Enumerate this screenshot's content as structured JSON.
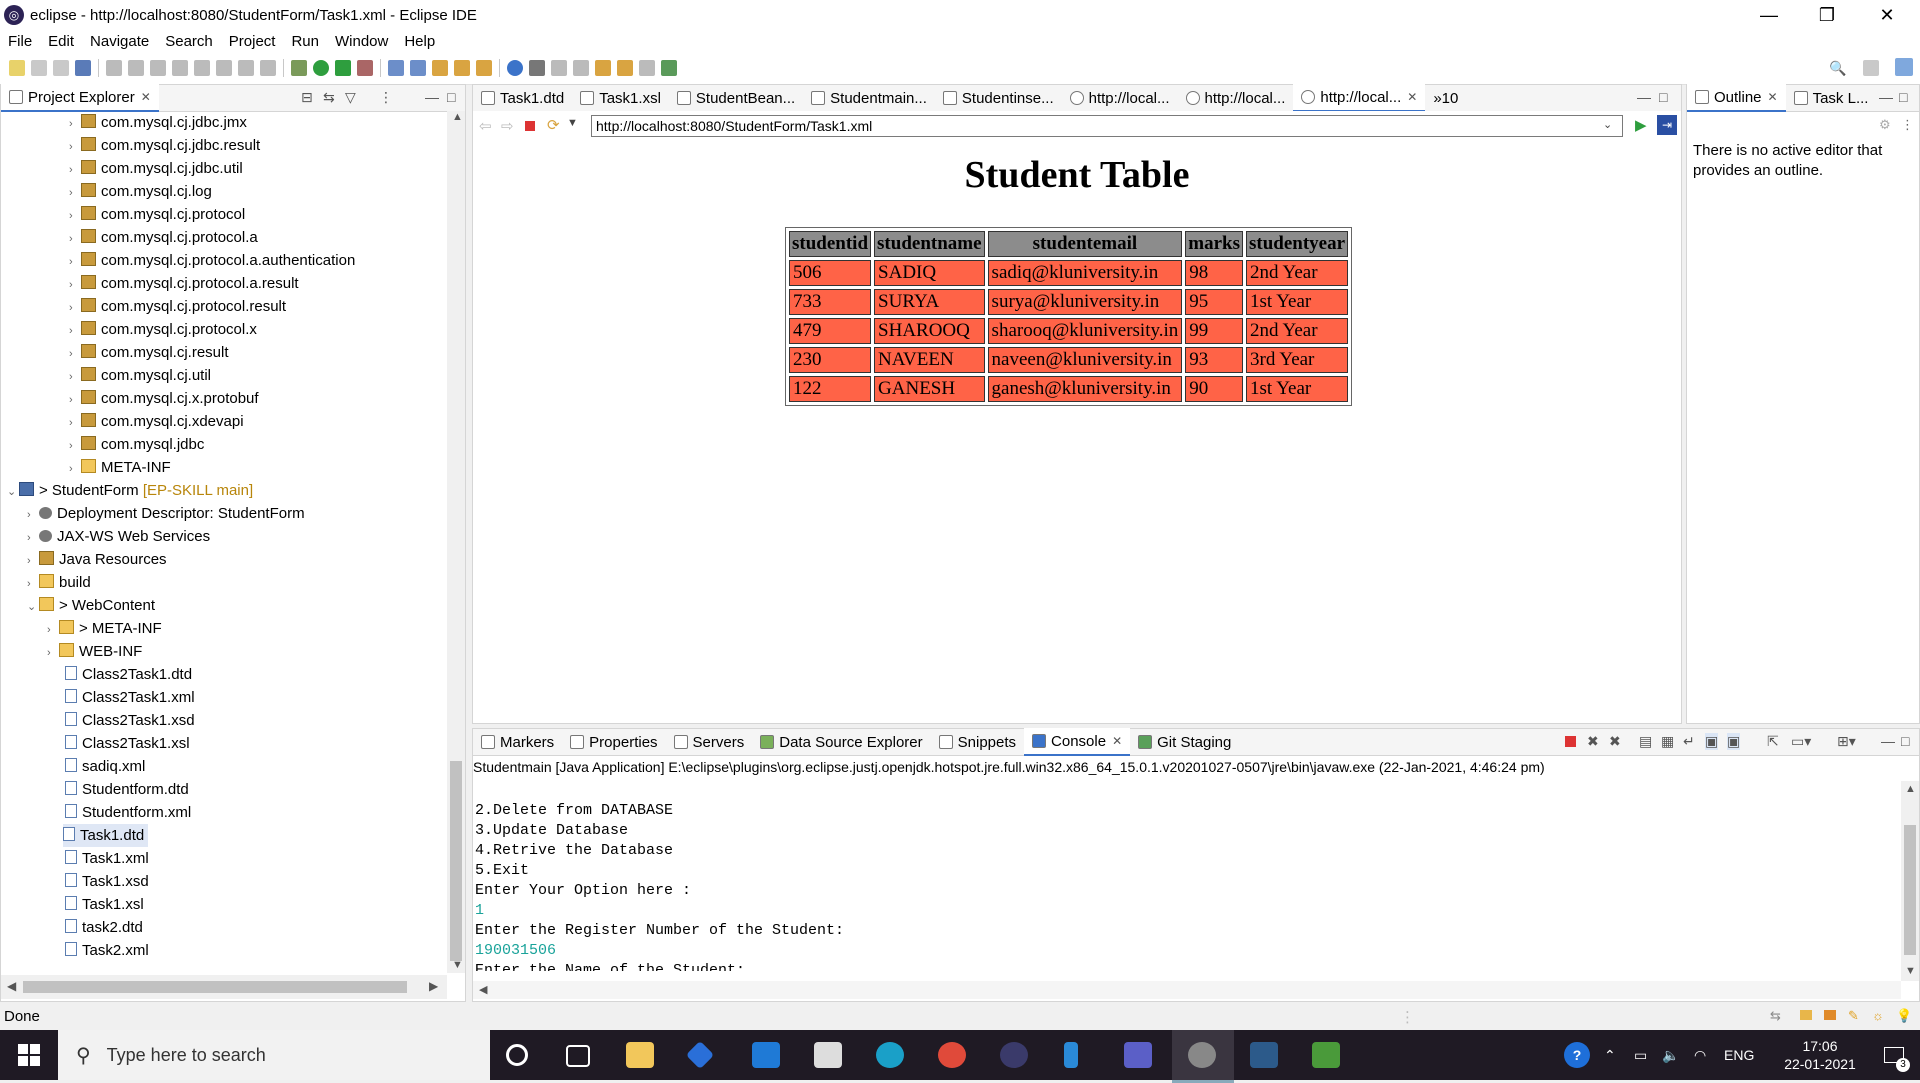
{
  "window": {
    "title": "eclipse - http://localhost:8080/StudentForm/Task1.xml - Eclipse IDE"
  },
  "menu": [
    "File",
    "Edit",
    "Navigate",
    "Search",
    "Project",
    "Run",
    "Window",
    "Help"
  ],
  "project_explorer": {
    "tab": "Project Explorer",
    "tree": [
      {
        "label": "com.mysql.cj.jdbc.jmx"
      },
      {
        "label": "com.mysql.cj.jdbc.result"
      },
      {
        "label": "com.mysql.cj.jdbc.util"
      },
      {
        "label": "com.mysql.cj.log"
      },
      {
        "label": "com.mysql.cj.protocol"
      },
      {
        "label": "com.mysql.cj.protocol.a"
      },
      {
        "label": "com.mysql.cj.protocol.a.authentication"
      },
      {
        "label": "com.mysql.cj.protocol.a.result"
      },
      {
        "label": "com.mysql.cj.protocol.result"
      },
      {
        "label": "com.mysql.cj.protocol.x"
      },
      {
        "label": "com.mysql.cj.result"
      },
      {
        "label": "com.mysql.cj.util"
      },
      {
        "label": "com.mysql.cj.x.protobuf"
      },
      {
        "label": "com.mysql.cj.xdevapi"
      },
      {
        "label": "com.mysql.jdbc"
      },
      {
        "label": "META-INF"
      },
      {
        "label": "> StudentForm",
        "suffix": "[EP-SKILL main]"
      },
      {
        "label": "Deployment Descriptor: StudentForm"
      },
      {
        "label": "JAX-WS Web Services"
      },
      {
        "label": "Java Resources"
      },
      {
        "label": "build"
      },
      {
        "label": "> WebContent"
      },
      {
        "label": "> META-INF"
      },
      {
        "label": "WEB-INF"
      },
      {
        "label": "Class2Task1.dtd"
      },
      {
        "label": "Class2Task1.xml"
      },
      {
        "label": "Class2Task1.xsd"
      },
      {
        "label": "Class2Task1.xsl"
      },
      {
        "label": "sadiq.xml"
      },
      {
        "label": "Studentform.dtd"
      },
      {
        "label": "Studentform.xml"
      },
      {
        "label": "Task1.dtd"
      },
      {
        "label": "Task1.xml"
      },
      {
        "label": "Task1.xsd"
      },
      {
        "label": "Task1.xsl"
      },
      {
        "label": "task2.dtd"
      },
      {
        "label": "Task2.xml"
      }
    ]
  },
  "editor": {
    "tabs": [
      "Task1.dtd",
      "Task1.xsl",
      "StudentBean...",
      "Studentmain...",
      "Studentinse...",
      "http://local...",
      "http://local...",
      "http://local..."
    ],
    "overflow": "»10",
    "url": "http://localhost:8080/StudentForm/Task1.xml",
    "page_title": "Student Table",
    "table": {
      "headers": [
        "studentid",
        "studentname",
        "studentemail",
        "marks",
        "studentyear"
      ],
      "rows": [
        [
          "506",
          "SADIQ",
          "sadiq@kluniversity.in",
          "98",
          "2nd Year"
        ],
        [
          "733",
          "SURYA",
          "surya@kluniversity.in",
          "95",
          "1st Year"
        ],
        [
          "479",
          "SHAROOQ",
          "sharooq@kluniversity.in",
          "99",
          "2nd Year"
        ],
        [
          "230",
          "NAVEEN",
          "naveen@kluniversity.in",
          "93",
          "3rd Year"
        ],
        [
          "122",
          "GANESH",
          "ganesh@kluniversity.in",
          "90",
          "1st Year"
        ]
      ]
    }
  },
  "outline": {
    "tabs": [
      "Outline",
      "Task L..."
    ],
    "message": "There is no active editor that provides an outline."
  },
  "console_panel": {
    "tabs": [
      "Markers",
      "Properties",
      "Servers",
      "Data Source Explorer",
      "Snippets",
      "Console",
      "Git Staging"
    ],
    "header": "Studentmain [Java Application] E:\\eclipse\\plugins\\org.eclipse.justj.openjdk.hotspot.jre.full.win32.x86_64_15.0.1.v20201027-0507\\jre\\bin\\javaw.exe  (22-Jan-2021, 4:46:24 pm)",
    "lines": [
      {
        "text": "2.Delete from DATABASE",
        "input": false
      },
      {
        "text": "3.Update Database",
        "input": false
      },
      {
        "text": "4.Retrive the Database",
        "input": false
      },
      {
        "text": "5.Exit",
        "input": false
      },
      {
        "text": "Enter Your Option here :",
        "input": false
      },
      {
        "text": "1",
        "input": true
      },
      {
        "text": "Enter the Register Number of the Student:",
        "input": false
      },
      {
        "text": "190031506",
        "input": true
      },
      {
        "text": "Enter the Name of the Student:",
        "input": false
      }
    ]
  },
  "status": {
    "left": "Done"
  },
  "taskbar": {
    "search_placeholder": "Type here to search",
    "lang": "ENG",
    "time": "17:06",
    "date": "22-01-2021",
    "notifications": "3"
  },
  "colors": {
    "row": "#ff6347",
    "header": "#8c8c8c",
    "accent": "#3b73c9",
    "console_input": "#1aa39a"
  }
}
